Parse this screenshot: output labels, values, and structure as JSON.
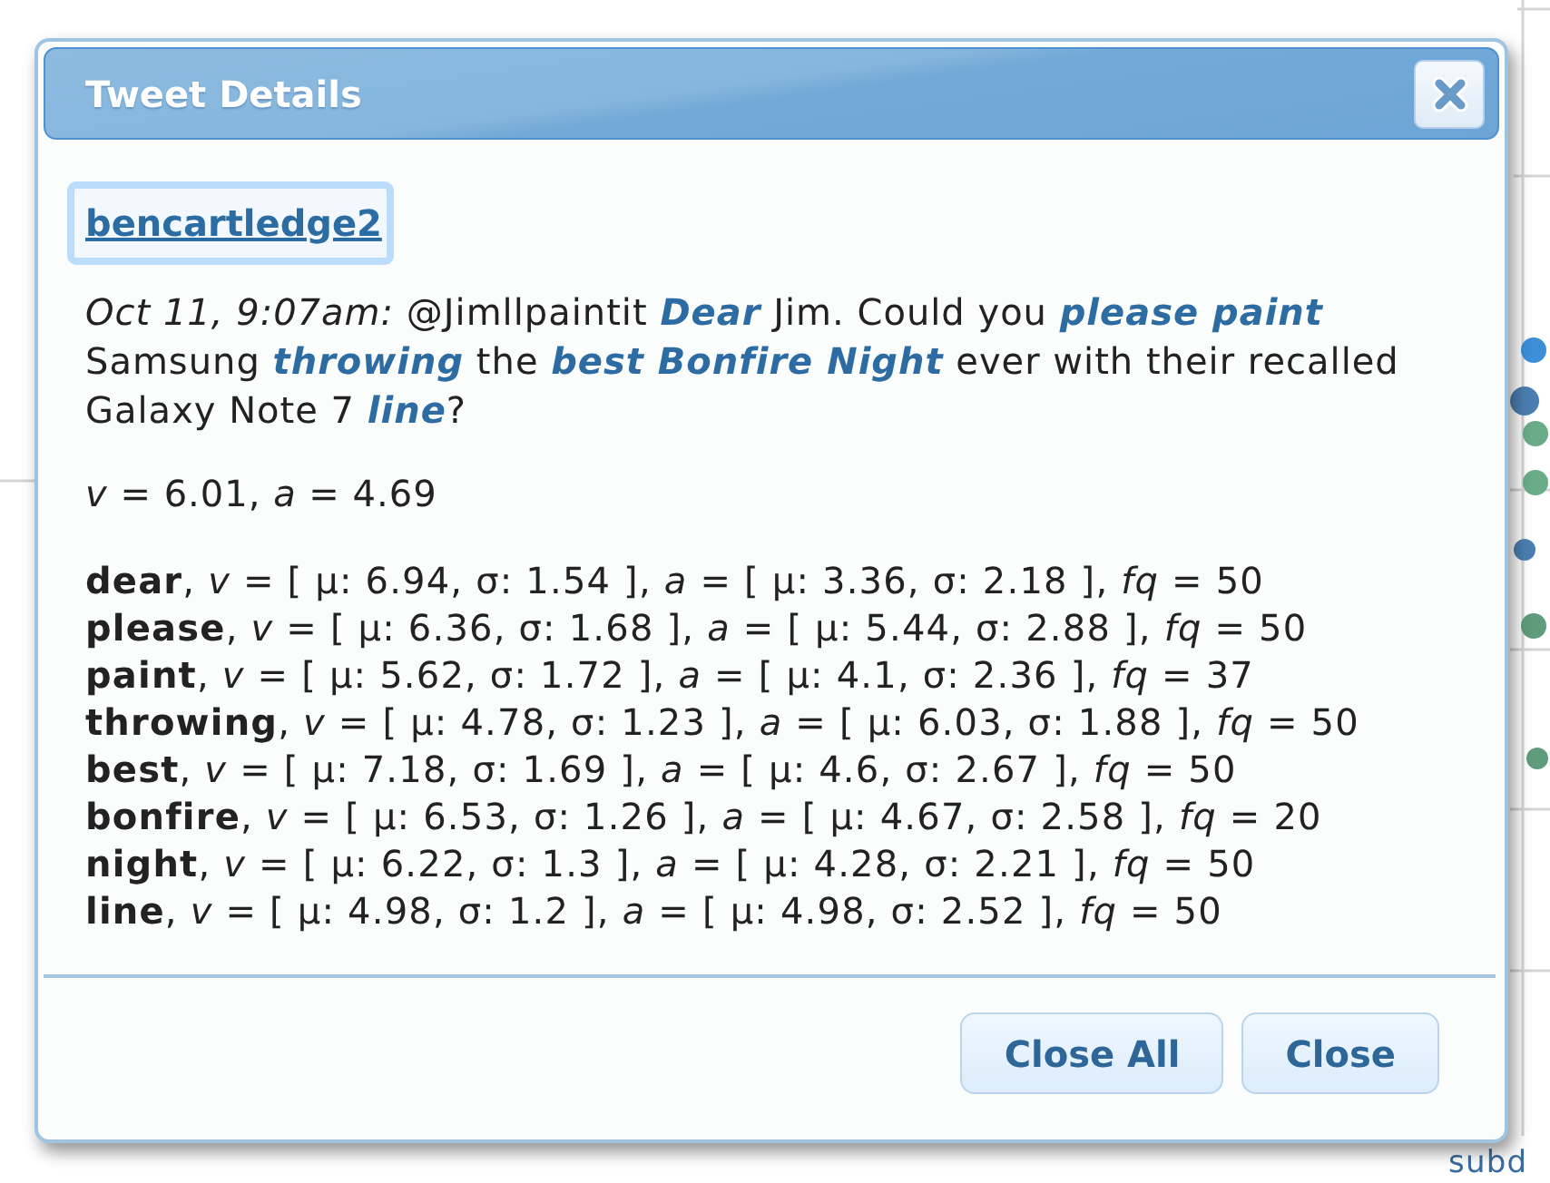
{
  "dialog": {
    "title": "Tweet Details",
    "user_link": {
      "text": "bencartledge2",
      "focused": true
    },
    "tweet": [
      {
        "kind": "timestamp",
        "text": "Oct 11, 9:07am:"
      },
      {
        "kind": "plain",
        "text": " @Jimllpaintit "
      },
      {
        "kind": "keyword",
        "text": "Dear"
      },
      {
        "kind": "plain",
        "text": " Jim. Could you "
      },
      {
        "kind": "keyword",
        "text": "please paint"
      },
      {
        "kind": "plain",
        "text": " Samsung "
      },
      {
        "kind": "keyword",
        "text": "throwing"
      },
      {
        "kind": "plain",
        "text": " the "
      },
      {
        "kind": "keyword",
        "text": "best Bonfire Night"
      },
      {
        "kind": "plain",
        "text": " ever with their recalled Galaxy Note 7 "
      },
      {
        "kind": "keyword",
        "text": "line"
      },
      {
        "kind": "plain",
        "text": "?"
      }
    ],
    "scores": "*v* = 6.01, *a* = 4.69",
    "word_stats": [
      "**dear**, *v* = [ μ: 6.94, σ: 1.54 ], *a* = [ μ: 3.36, σ: 2.18 ], *fq* = 50",
      "**please**, *v* = [ μ: 6.36, σ: 1.68 ], *a* = [ μ: 5.44, σ: 2.88 ], *fq* = 50",
      "**paint**, *v* = [ μ: 5.62, σ: 1.72 ], *a* = [ μ: 4.1, σ: 2.36 ], *fq* = 37",
      "**throwing**, *v* = [ μ: 4.78, σ: 1.23 ], *a* = [ μ: 6.03, σ: 1.88 ], *fq* = 50",
      "**best**, *v* = [ μ: 7.18, σ: 1.69 ], *a* = [ μ: 4.6, σ: 2.67 ], *fq* = 50",
      "**bonfire**, *v* = [ μ: 6.53, σ: 1.26 ], *a* = [ μ: 4.67, σ: 2.58 ], *fq* = 20",
      "**night**, *v* = [ μ: 6.22, σ: 1.3 ], *a* = [ μ: 4.28, σ: 2.21 ], *fq* = 50",
      "**line**, *v* = [ μ: 4.98, σ: 1.2 ], *a* = [ μ: 4.98, σ: 2.52 ], *fq* = 50"
    ],
    "buttons": [
      "Close All",
      "Close"
    ]
  },
  "background_chart": {
    "points": [
      {
        "color": "#3c8ed6"
      },
      {
        "color": "#4b7fb1"
      },
      {
        "color": "#6aab88"
      },
      {
        "color": "#6aab88"
      },
      {
        "color": "#4b7fb1"
      },
      {
        "color": "#5e9c7b"
      },
      {
        "color": "#5e9c7b"
      }
    ],
    "axis_label": "subd"
  }
}
